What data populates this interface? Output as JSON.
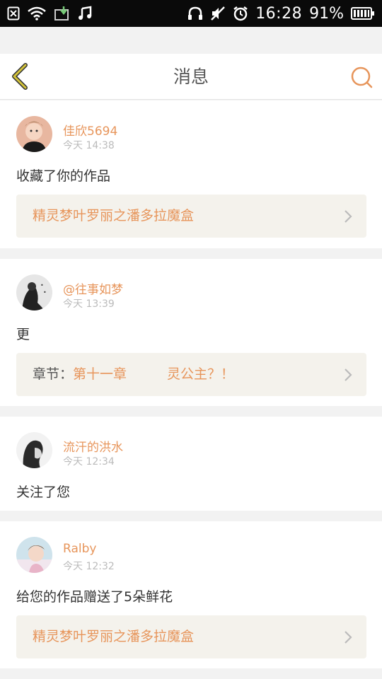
{
  "status_bar": {
    "time": "16:28",
    "battery": "91%",
    "icons": [
      "sim-blocked-icon",
      "wifi-icon",
      "download-icon",
      "music-note-icon",
      "headphones-icon",
      "mute-icon",
      "alarm-icon",
      "battery-icon"
    ]
  },
  "header": {
    "title": "消息",
    "back_icon": "chevron-left-icon",
    "search_icon": "search-icon"
  },
  "colors": {
    "accent": "#e7955b",
    "back_icon": "#d4c43a",
    "link_bg": "#f4f2ec"
  },
  "messages": [
    {
      "user": "佳欣5694",
      "time": "今天 14:38",
      "text": "收藏了你的作品",
      "link": {
        "prefix": "",
        "title": "精灵梦叶罗丽之潘多拉魔盒"
      }
    },
    {
      "user": "@往事如梦",
      "time": "今天 13:39",
      "text": "更",
      "link": {
        "prefix": "章节：",
        "title": "第十一章　　　灵公主？！"
      }
    },
    {
      "user": "流汗的洪水",
      "time": "今天 12:34",
      "text": "关注了您"
    },
    {
      "user": "Ralby",
      "time": "今天 12:32",
      "text": "给您的作品赠送了5朵鲜花",
      "link": {
        "prefix": "",
        "title": "精灵梦叶罗丽之潘多拉魔盒"
      }
    }
  ]
}
